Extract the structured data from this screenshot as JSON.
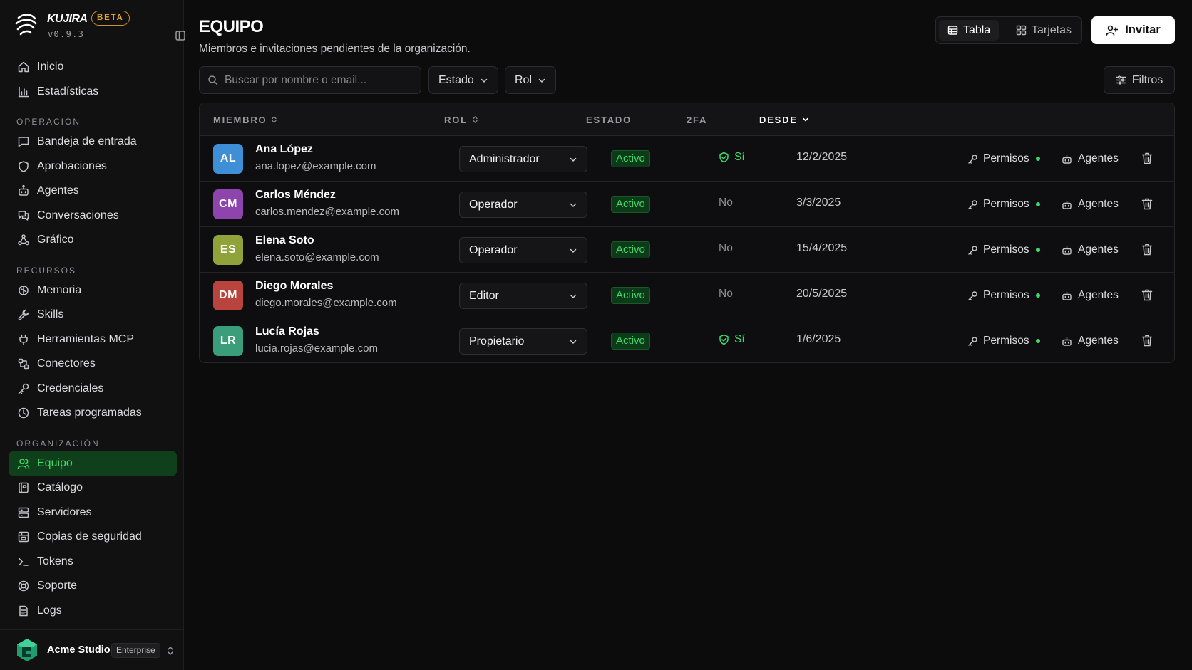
{
  "brand": {
    "name": "KUJIRA",
    "badge": "BETA",
    "version": "v0.9.3"
  },
  "sidebar": {
    "top": [
      {
        "label": "Inicio",
        "icon": "home-icon"
      },
      {
        "label": "Estadísticas",
        "icon": "bar-chart-icon"
      }
    ],
    "sections": [
      {
        "title": "OPERACIÓN",
        "items": [
          {
            "label": "Bandeja de entrada",
            "icon": "inbox-message-icon"
          },
          {
            "label": "Aprobaciones",
            "icon": "shield-icon"
          },
          {
            "label": "Agentes",
            "icon": "bot-icon"
          },
          {
            "label": "Conversaciones",
            "icon": "chat-icon"
          },
          {
            "label": "Gráfico",
            "icon": "graph-icon"
          }
        ]
      },
      {
        "title": "RECURSOS",
        "items": [
          {
            "label": "Memoria",
            "icon": "brain-icon"
          },
          {
            "label": "Skills",
            "icon": "wrench-icon"
          },
          {
            "label": "Herramientas MCP",
            "icon": "plug-icon"
          },
          {
            "label": "Conectores",
            "icon": "connector-icon"
          },
          {
            "label": "Credenciales",
            "icon": "key-icon"
          },
          {
            "label": "Tareas programadas",
            "icon": "clock-icon"
          }
        ]
      },
      {
        "title": "ORGANIZACIÓN",
        "items": [
          {
            "label": "Equipo",
            "icon": "users-icon",
            "active": true
          },
          {
            "label": "Catálogo",
            "icon": "catalog-icon"
          },
          {
            "label": "Servidores",
            "icon": "server-icon"
          },
          {
            "label": "Copias de seguridad",
            "icon": "backup-icon"
          },
          {
            "label": "Tokens",
            "icon": "terminal-icon"
          },
          {
            "label": "Soporte",
            "icon": "lifebuoy-icon"
          },
          {
            "label": "Logs",
            "icon": "file-text-icon"
          }
        ]
      }
    ]
  },
  "org": {
    "name": "Acme Studio",
    "plan": "Enterprise"
  },
  "header": {
    "title": "EQUIPO",
    "subtitle": "Miembros e invitaciones pendientes de la organización.",
    "view_table": "Tabla",
    "view_cards": "Tarjetas",
    "invite": "Invitar"
  },
  "toolbar": {
    "search_placeholder": "Buscar por nombre o email...",
    "status_filter": "Estado",
    "role_filter": "Rol",
    "filters": "Filtros"
  },
  "table": {
    "columns": [
      "MIEMBRO",
      "ROL",
      "ESTADO",
      "2FA",
      "DESDE"
    ],
    "sorted_column": "DESDE",
    "permissions_label": "Permisos",
    "agents_label": "Agentes",
    "rows": [
      {
        "initials": "AL",
        "avatar_color": "#3f8fd6",
        "name": "Ana López",
        "email": "ana.lopez@example.com",
        "role": "Administrador",
        "status": "Activo",
        "tfa": "Sí",
        "tfa_enabled": true,
        "since": "12/2/2025"
      },
      {
        "initials": "CM",
        "avatar_color": "#8e44ad",
        "name": "Carlos Méndez",
        "email": "carlos.mendez@example.com",
        "role": "Operador",
        "status": "Activo",
        "tfa": "No",
        "tfa_enabled": false,
        "since": "3/3/2025"
      },
      {
        "initials": "ES",
        "avatar_color": "#8fa33a",
        "name": "Elena Soto",
        "email": "elena.soto@example.com",
        "role": "Operador",
        "status": "Activo",
        "tfa": "No",
        "tfa_enabled": false,
        "since": "15/4/2025"
      },
      {
        "initials": "DM",
        "avatar_color": "#b9443e",
        "name": "Diego Morales",
        "email": "diego.morales@example.com",
        "role": "Editor",
        "status": "Activo",
        "tfa": "No",
        "tfa_enabled": false,
        "since": "20/5/2025"
      },
      {
        "initials": "LR",
        "avatar_color": "#3a9e7a",
        "name": "Lucía Rojas",
        "email": "lucia.rojas@example.com",
        "role": "Propietario",
        "status": "Activo",
        "tfa": "Sí",
        "tfa_enabled": true,
        "since": "1/6/2025"
      }
    ]
  },
  "colors": {
    "accent": "#3ddc6a",
    "active_nav_bg": "#0f3f1b",
    "beta_badge": "#e8a838"
  }
}
